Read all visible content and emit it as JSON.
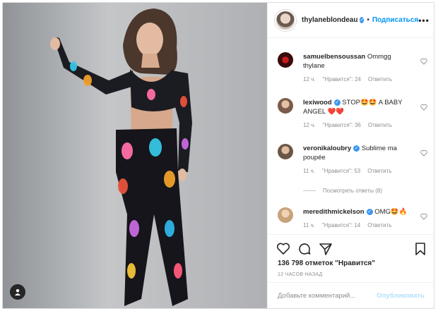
{
  "post": {
    "author": "thylaneblondeau",
    "follow": "Подписаться",
    "dot": "•",
    "more": "•••"
  },
  "comments": [
    {
      "user": "samuelbensoussan",
      "text": "Ommgg thylane",
      "time": "12 ч.",
      "likes": "\"Нравится\": 24",
      "reply": "Ответить",
      "avatar_color": "#3a0b0b"
    },
    {
      "user": "lexiwood",
      "text": "STOP🤩🤩 A BABY ANGEL ❤️❤️",
      "time": "12 ч.",
      "likes": "\"Нравится\": 36",
      "reply": "Ответить",
      "avatar_color": "#7a5a48"
    },
    {
      "user": "veronikaloubry",
      "text": "Sublime ma poupée",
      "time": "11 ч.",
      "likes": "\"Нравится\": 53",
      "reply": "Ответить",
      "avatar_color": "#6a5646"
    },
    {
      "user": "meredithmickelson",
      "text": "OMG🤩🔥",
      "time": "11 ч.",
      "likes": "\"Нравится\": 14",
      "reply": "Ответить",
      "avatar_color": "#c8a27a"
    }
  ],
  "thread": {
    "label": "Посмотреть ответы (8)"
  },
  "likes_text": "136 798 отметок \"Нравится\"",
  "posted_ago": "12 ЧАСОВ НАЗАД",
  "add_comment": {
    "placeholder": "Добавьте комментарий...",
    "post_label": "Опубликовать"
  },
  "icons": [
    "heart-icon",
    "comment-icon",
    "share-icon",
    "bookmark-icon",
    "user-tag-icon",
    "verified-icon",
    "more-icon"
  ]
}
